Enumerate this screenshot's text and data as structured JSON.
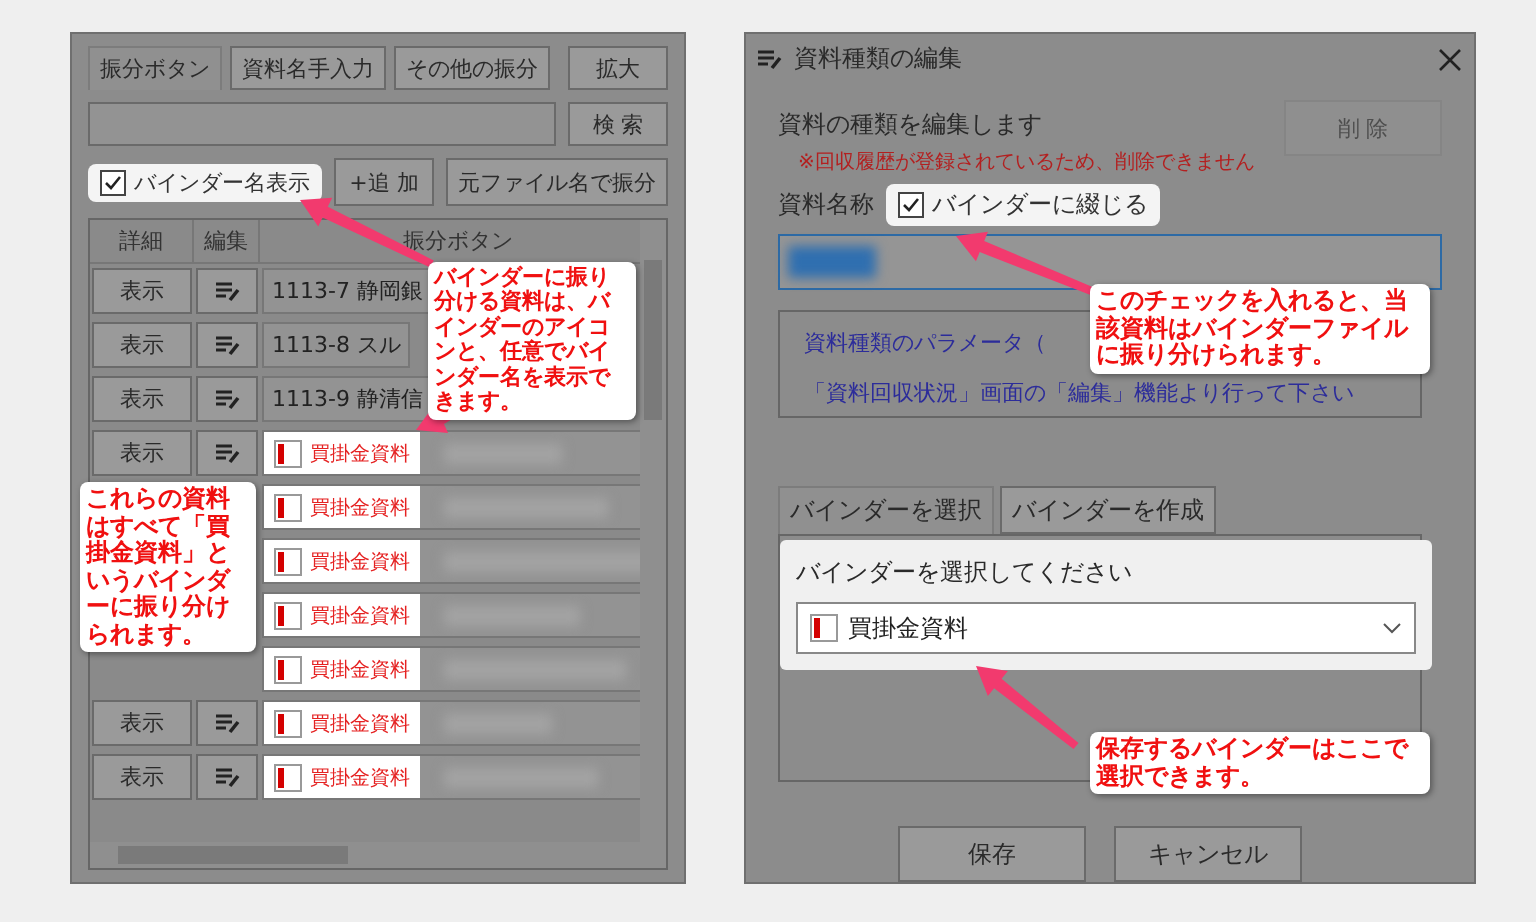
{
  "left_panel": {
    "tabs": [
      {
        "label": "振分ボタン",
        "selected": true
      },
      {
        "label": "資料名手入力",
        "selected": false
      },
      {
        "label": "その他の振分",
        "selected": false
      }
    ],
    "expand_button": "拡大",
    "search_button": "検 索",
    "show_binder_name": {
      "label": "バインダー名表示",
      "checked": true
    },
    "add_button": "+追 加",
    "split_button": "元ファイル名で振分",
    "table": {
      "columns": [
        "詳細",
        "編集",
        "振分ボタン"
      ],
      "rows": [
        {
          "kind": "text",
          "detail": "表示",
          "name": "1113-7 静岡銀"
        },
        {
          "kind": "text",
          "detail": "表示",
          "name": "1113-8 スル"
        },
        {
          "kind": "text",
          "detail": "表示",
          "name": "1113-9 静清信"
        },
        {
          "kind": "binder",
          "detail": "表示",
          "binder": "買掛金資料"
        },
        {
          "kind": "binder",
          "binder": "買掛金資料"
        },
        {
          "kind": "binder",
          "binder": "買掛金資料"
        },
        {
          "kind": "binder",
          "binder": "買掛金資料"
        },
        {
          "kind": "binder",
          "binder": "買掛金資料"
        },
        {
          "kind": "binder",
          "detail": "表示",
          "binder": "買掛金資料"
        },
        {
          "kind": "binder",
          "detail": "表示",
          "binder": "買掛金資料"
        }
      ]
    }
  },
  "dialog": {
    "title": "資料種類の編集",
    "heading": "資料の種類を編集します",
    "warning": "※回収履歴が登録されているため、削除できません",
    "delete_button": {
      "label": "削 除",
      "disabled": true
    },
    "name_label": "資料名称",
    "bind_checkbox": {
      "label": "バインダーに綴じる",
      "checked": true
    },
    "info_lines": [
      "資料種類のパラメータ（",
      "「資料回収状況」画面の「編集」機能より行って下さい"
    ],
    "tabs": [
      {
        "label": "バインダーを選択",
        "selected": true
      },
      {
        "label": "バインダーを作成",
        "selected": false
      }
    ],
    "select_prompt": "バインダーを選択してください",
    "binder_select": {
      "value": "買掛金資料"
    },
    "buttons": [
      "保存",
      "キャンセル"
    ]
  },
  "annotations": [
    {
      "text": "バインダーに振り分ける資料は、バインダーのアイコンと、任意でバインダー名を表示できます。"
    },
    {
      "text": "これらの資料はすべて「買掛金資料」というバインダーに振り分けられます。"
    },
    {
      "text": "このチェックを入れると、当該資料はバインダーファイルに振り分けられます。"
    },
    {
      "text": "保存するバインダーはここで選択できます。"
    }
  ]
}
